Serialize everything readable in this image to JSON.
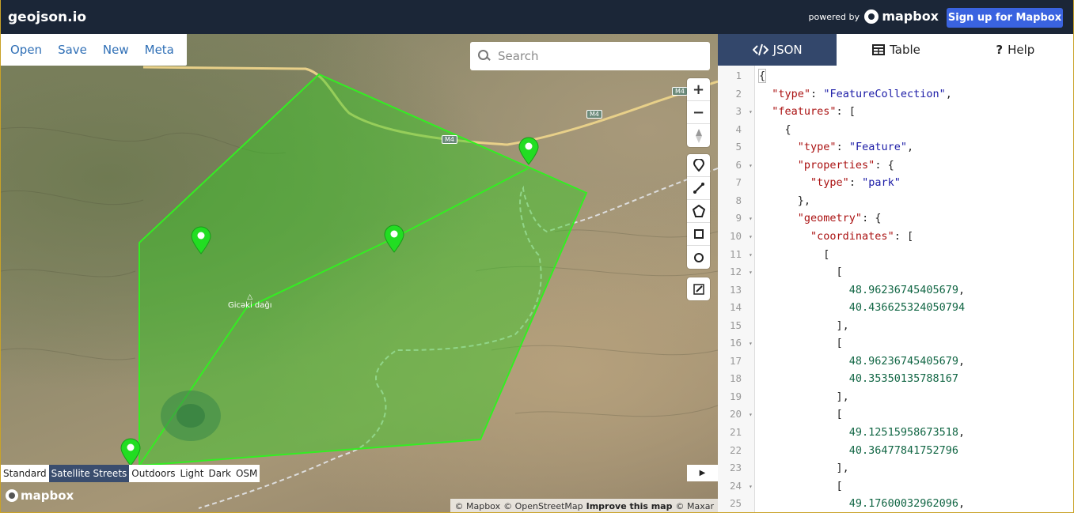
{
  "app": {
    "brand": "geojson.io",
    "powered_by": "powered by",
    "mapbox": "mapbox",
    "signup": "Sign up for Mapbox"
  },
  "file_menu": [
    "Open",
    "Save",
    "New",
    "Meta"
  ],
  "search": {
    "placeholder": "Search"
  },
  "map": {
    "map_styles": [
      {
        "label": "Standard",
        "active": false
      },
      {
        "label": "Satellite Streets",
        "active": true
      },
      {
        "label": "Outdoors",
        "active": false
      },
      {
        "label": "Light",
        "active": false
      },
      {
        "label": "Dark",
        "active": false
      },
      {
        "label": "OSM",
        "active": false
      }
    ],
    "place_label": "Gicəki dağı",
    "road_labels": [
      "M4",
      "M4",
      "M4"
    ],
    "attribution": {
      "mapbox": "© Mapbox",
      "osm": "© OpenStreetMap",
      "improve": "Improve this map",
      "maxar": "© Maxar"
    },
    "bottom_logo": "mapbox",
    "polygon_color": "#33cc22",
    "marker_color": "#22dd22"
  },
  "panel": {
    "tabs": [
      {
        "label": "JSON",
        "icon": "code-icon",
        "active": true
      },
      {
        "label": "Table",
        "icon": "table-icon",
        "active": false
      },
      {
        "label": "Help",
        "icon": "question-icon",
        "active": false
      }
    ],
    "lines": [
      "{",
      "  \"type\": \"FeatureCollection\",",
      "  \"features\": [",
      "    {",
      "      \"type\": \"Feature\",",
      "      \"properties\": {",
      "        \"type\": \"park\"",
      "      },",
      "      \"geometry\": {",
      "        \"coordinates\": [",
      "          [",
      "            [",
      "              48.96236745405679,",
      "              40.436625324050794",
      "            ],",
      "            [",
      "              48.96236745405679,",
      "              40.35350135788167",
      "            ],",
      "            [",
      "              49.12515958673518,",
      "              40.36477841752796",
      "            ],",
      "            [",
      "              49.17600032962096,"
    ],
    "folds": [
      3,
      6,
      9,
      10,
      11,
      12,
      16,
      20,
      24
    ]
  }
}
